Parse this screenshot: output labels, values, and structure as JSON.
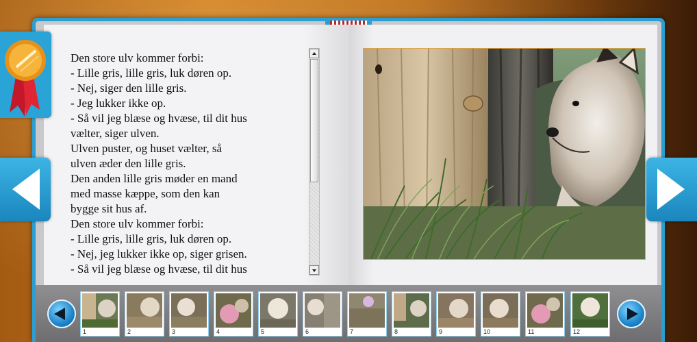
{
  "story": {
    "lines": [
      "Den store ulv kommer forbi:",
      "- Lille gris, lille gris, luk døren op.",
      "- Nej, siger den lille gris.",
      "- Jeg lukker ikke op.",
      "- Så vil jeg blæse og hvæse, til dit hus",
      "vælter, siger ulven.",
      "Ulven puster, og huset vælter, så",
      "ulven æder den lille gris.",
      "Den anden lille gris møder en mand",
      "med masse kæppe, som den kan",
      "bygge sit hus af.",
      "Den store ulv kommer forbi:",
      "- Lille gris, lille gris, luk døren op.",
      "- Nej, jeg lukker ikke op, siger grisen.",
      "- Så vil jeg blæse og hvæse, til dit hus"
    ]
  },
  "thumbnails": [
    "1",
    "2",
    "3",
    "4",
    "5",
    "6",
    "7",
    "8",
    "9",
    "10",
    "11",
    "12"
  ],
  "colors": {
    "frame": "#2c9fd2",
    "accent_border": "#e0a13c",
    "thumb_border": "#8fd0ef"
  },
  "icons": {
    "badge": "award-ribbon-icon",
    "prev_page": "arrow-left-icon",
    "next_page": "arrow-right-icon",
    "thumb_prev": "play-left-icon",
    "thumb_next": "play-right-icon"
  }
}
